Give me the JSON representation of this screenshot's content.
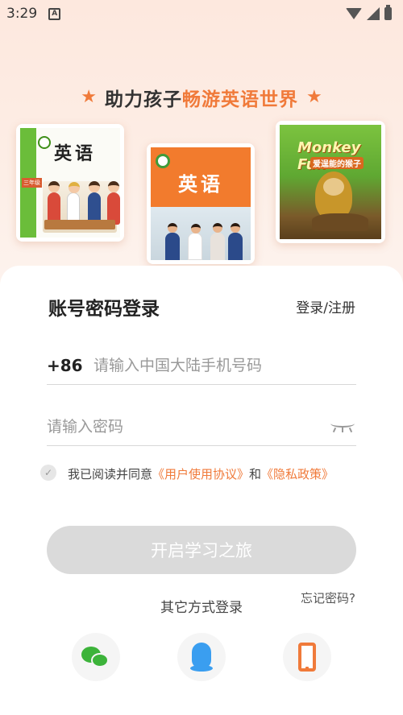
{
  "status_bar": {
    "time": "3:29",
    "notif_icon_letter": "A"
  },
  "header": {
    "slogan_prefix": "助力孩子",
    "slogan_highlight": "畅游英语世界",
    "star_glyph": "★"
  },
  "books": [
    {
      "title": "英语",
      "grade_tag": "三年级",
      "icon": "textbook-cover-grade3"
    },
    {
      "title": "英语",
      "icon": "textbook-cover-grade7"
    },
    {
      "title": "Monkey Fun",
      "subtitle": "爱逞能的猴子",
      "icon": "picture-book-monkey-fun"
    }
  ],
  "login": {
    "title": "账号密码登录",
    "register_link": "登录/注册",
    "country_code": "+86",
    "phone_placeholder": "请输入中国大陆手机号码",
    "phone_value": "",
    "password_placeholder": "请输入密码",
    "password_value": "",
    "agree_prefix": "我已阅读并同意",
    "agree_link_terms": "《用户使用协议》",
    "agree_and": "和",
    "agree_link_privacy": "《隐私政策》",
    "start_button": "开启学习之旅",
    "forgot_link": "忘记密码?",
    "other_methods_title": "其它方式登录"
  },
  "other_login_options": [
    {
      "name": "wechat",
      "icon": "wechat-icon"
    },
    {
      "name": "qq",
      "icon": "qq-icon"
    },
    {
      "name": "phone",
      "icon": "phone-icon"
    }
  ],
  "colors": {
    "accent": "#f07a3a",
    "disabled_button": "#dadada",
    "wechat": "#3cb33a",
    "qq": "#3a9ef0"
  }
}
